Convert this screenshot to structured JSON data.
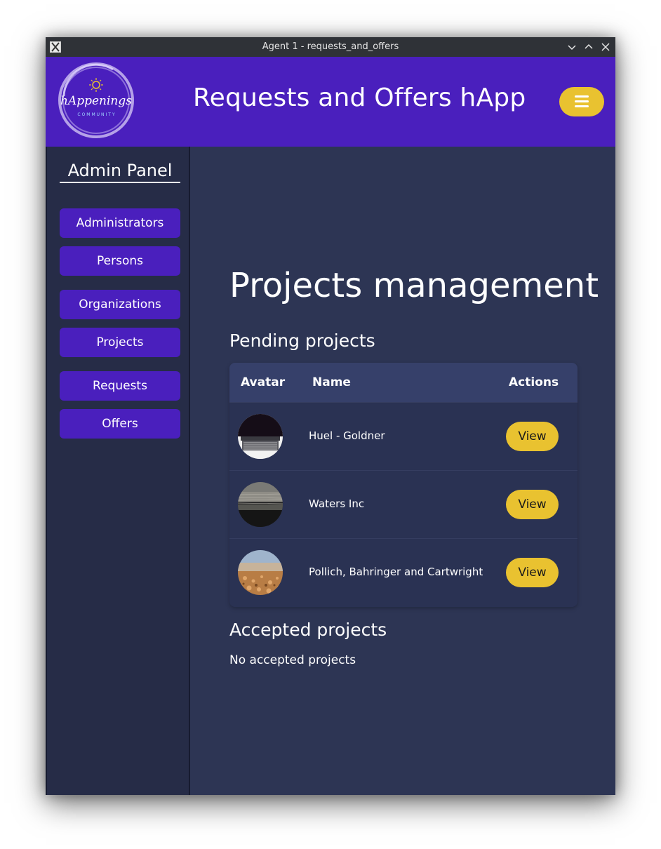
{
  "window": {
    "title": "Agent 1 - requests_and_offers"
  },
  "header": {
    "logo_text": "hAppenings",
    "logo_subtext": "COMMUNITY",
    "app_title": "Requests and Offers hApp"
  },
  "sidebar": {
    "title": "Admin Panel",
    "items": [
      {
        "label": "Administrators"
      },
      {
        "label": "Persons"
      },
      {
        "label": "Organizations"
      },
      {
        "label": "Projects"
      },
      {
        "label": "Requests"
      },
      {
        "label": "Offers"
      }
    ]
  },
  "main": {
    "title": "Projects management",
    "pending": {
      "title": "Pending projects",
      "columns": [
        "Avatar",
        "Name",
        "Actions"
      ],
      "rows": [
        {
          "name": "Huel - Goldner",
          "action": "View",
          "avatar_icon": "laptop-photo"
        },
        {
          "name": "Waters Inc",
          "action": "View",
          "avatar_icon": "dark-landscape-photo"
        },
        {
          "name": "Pollich, Bahringer and Cartwright",
          "action": "View",
          "avatar_icon": "pebbles-photo"
        }
      ]
    },
    "accepted": {
      "title": "Accepted projects",
      "empty_message": "No accepted projects"
    }
  },
  "colors": {
    "brand_purple": "#4a1fbd",
    "accent_yellow": "#e9c230",
    "sidebar_bg": "#262c47",
    "main_bg": "#2d3554",
    "table_header_bg": "#36406a"
  }
}
